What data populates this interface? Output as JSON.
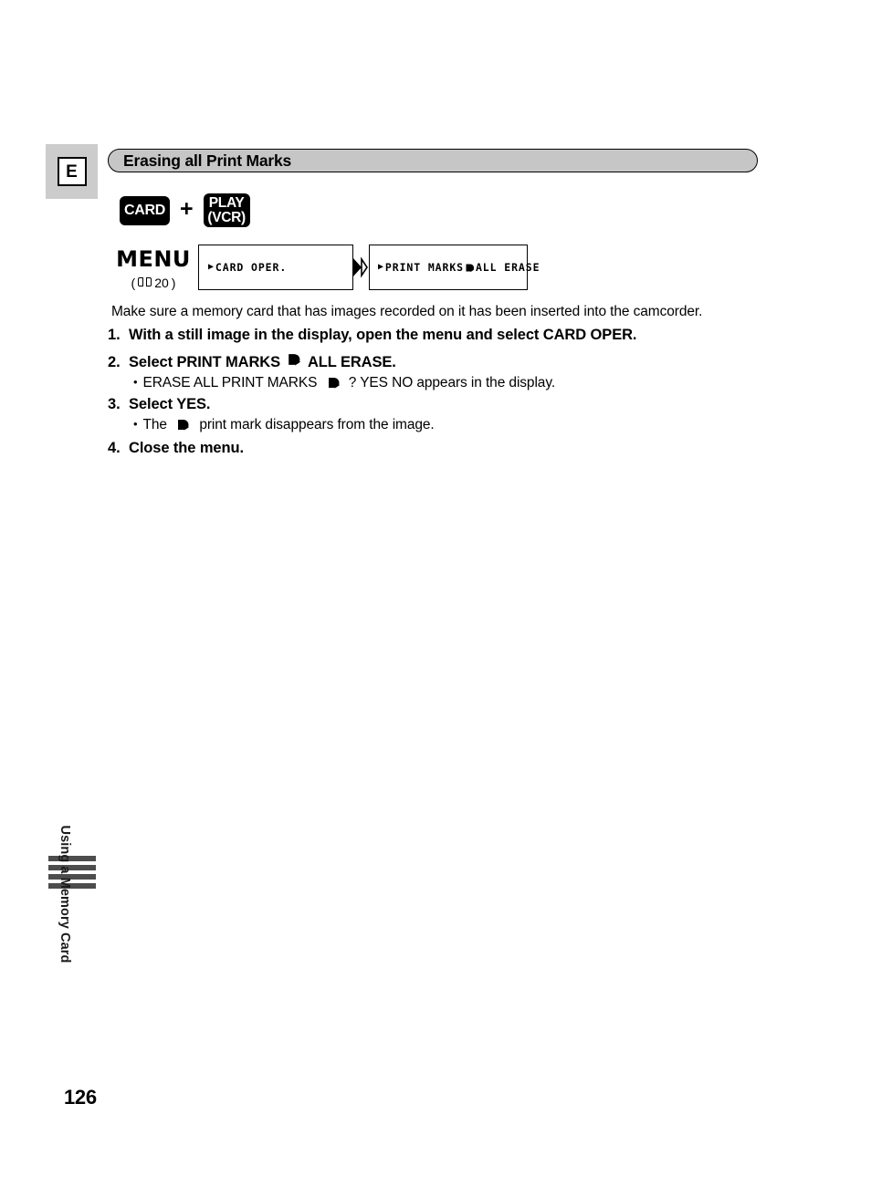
{
  "page": {
    "language_tag": "E",
    "number": "126",
    "chapter_title": "Using a Memory Card"
  },
  "section": {
    "title": "Erasing all Print Marks"
  },
  "buttons": {
    "card": "CARD",
    "plus": "+",
    "play_line1": "PLAY",
    "play_line2": "(VCR)"
  },
  "menu": {
    "label": "MENU",
    "ref_open": "(",
    "ref_page": "20",
    "ref_close": ")",
    "book_icon": "book-icon",
    "caret": "▶",
    "screen1": {
      "text": "CARD OPER."
    },
    "arrow_icon": "double-chevron-right-icon",
    "screen2": {
      "text_before": "PRINT MARKS",
      "print_mark_icon": "print-mark-icon",
      "text_after": "ALL ERASE"
    }
  },
  "intro": "Make sure a memory card that has images recorded on it has been inserted into the camcorder.",
  "steps": [
    {
      "num": "1.",
      "text": "With a still image in the display, open the menu and select CARD OPER.",
      "notes": []
    },
    {
      "num": "2.",
      "text_before": "Select PRINT MARKS",
      "print_mark_icon": "print-mark-icon",
      "text_after": "ALL ERASE.",
      "notes": [
        {
          "bullet": "•",
          "text_before": "ERASE ALL PRINT MARKS",
          "print_mark_icon": "print-mark-icon",
          "text_after": "? YES NO appears in the display."
        }
      ]
    },
    {
      "num": "3.",
      "text": "Select YES.",
      "notes": [
        {
          "bullet": "•",
          "text_before": "The",
          "print_mark_icon": "print-mark-icon",
          "text_after": "print mark disappears from the image."
        }
      ]
    },
    {
      "num": "4.",
      "text": "Close the menu.",
      "notes": []
    }
  ],
  "colors": {
    "header_bar": "#c6c6c6",
    "lang_block": "#cccccc",
    "side_bar": "#4d4d4d",
    "key_button": "#000000"
  }
}
